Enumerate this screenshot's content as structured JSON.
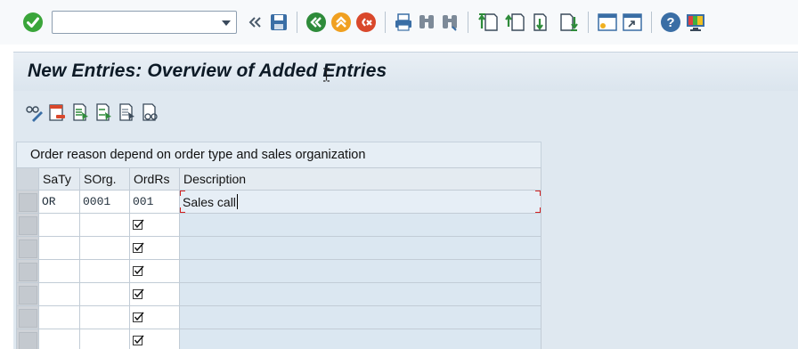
{
  "system_toolbar": {
    "command_field": {
      "value": "",
      "placeholder": ""
    },
    "icons": [
      "enter-icon",
      "back-double-chevron-icon",
      "save-icon",
      "back-icon",
      "exit-icon",
      "cancel-icon",
      "print-icon",
      "find-icon",
      "find-next-icon",
      "first-page-icon",
      "previous-page-icon",
      "next-page-icon",
      "last-page-icon",
      "new-session-icon",
      "create-shortcut-icon",
      "help-icon",
      "customize-layout-icon"
    ]
  },
  "title": "New Entries: Overview of Added Entries",
  "app_toolbar": {
    "icons": [
      "change-display-icon",
      "delete-icon",
      "select-all-icon",
      "select-block-icon",
      "deselect-all-icon",
      "where-used-icon"
    ]
  },
  "table": {
    "caption": "Order reason depend on order type and sales organization",
    "columns": [
      "SaTy",
      "SOrg.",
      "OrdRs",
      "Description"
    ],
    "rows": [
      {
        "saty": "OR",
        "sorg": "0001",
        "ordrs": "001",
        "description": "Sales call",
        "checked": false,
        "active": true
      },
      {
        "saty": "",
        "sorg": "",
        "ordrs": "",
        "description": "",
        "checked": true,
        "active": false
      },
      {
        "saty": "",
        "sorg": "",
        "ordrs": "",
        "description": "",
        "checked": true,
        "active": false
      },
      {
        "saty": "",
        "sorg": "",
        "ordrs": "",
        "description": "",
        "checked": true,
        "active": false
      },
      {
        "saty": "",
        "sorg": "",
        "ordrs": "",
        "description": "",
        "checked": true,
        "active": false
      },
      {
        "saty": "",
        "sorg": "",
        "ordrs": "",
        "description": "",
        "checked": true,
        "active": false
      },
      {
        "saty": "",
        "sorg": "",
        "ordrs": "",
        "description": "",
        "checked": true,
        "active": false
      }
    ]
  },
  "colors": {
    "enter_green": "#3aa53a",
    "back_green": "#2e8b3a",
    "exit_orange": "#f0a020",
    "cancel_red": "#d9482b",
    "toolbar_blue": "#3a6ea5",
    "title_bg": "#dbe5ee",
    "focus_red": "#d12020"
  }
}
